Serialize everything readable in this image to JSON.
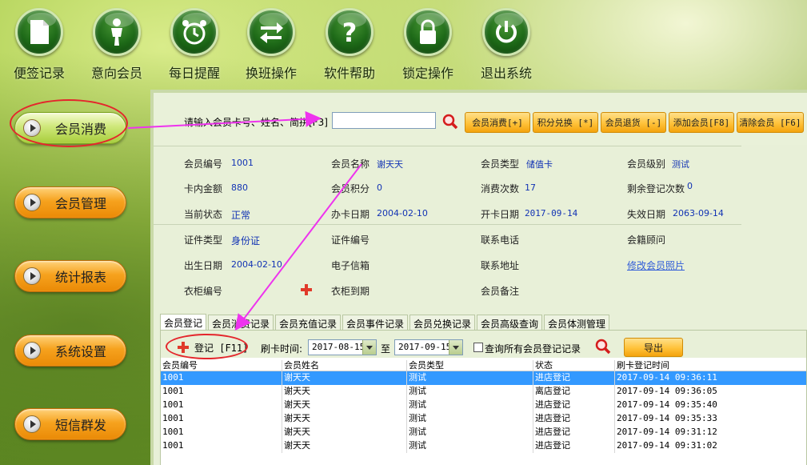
{
  "toolbar": {
    "items": [
      {
        "label": "便签记录",
        "icon": "document-icon"
      },
      {
        "label": "意向会员",
        "icon": "person-icon"
      },
      {
        "label": "每日提醒",
        "icon": "alarm-clock-icon"
      },
      {
        "label": "换班操作",
        "icon": "swap-arrows-icon"
      },
      {
        "label": "软件帮助",
        "icon": "question-icon"
      },
      {
        "label": "锁定操作",
        "icon": "lock-icon"
      },
      {
        "label": "退出系统",
        "icon": "power-icon"
      }
    ]
  },
  "sidebar": {
    "items": [
      {
        "label": "会员消费",
        "active": true
      },
      {
        "label": "会员管理",
        "active": false
      },
      {
        "label": "统计报表",
        "active": false
      },
      {
        "label": "系统设置",
        "active": false
      },
      {
        "label": "短信群发",
        "active": false
      }
    ]
  },
  "search": {
    "prompt": "请输入会员卡号、姓名、简拼[F3]",
    "value": "",
    "buttons": [
      "会员消费[+]",
      "积分兑换 [*]",
      "会员退货 [-]",
      "添加会员[F8]",
      "清除会员 [F6]"
    ]
  },
  "member": {
    "row1": {
      "no_label": "会员编号",
      "no": "1001",
      "name_label": "会员名称",
      "name": "谢天天",
      "type_label": "会员类型",
      "type": "储值卡",
      "level_label": "会员级别",
      "level": "测试"
    },
    "row2": {
      "balance_label": "卡内金额",
      "balance": "880",
      "points_label": "会员积分",
      "points": "0",
      "visits_label": "消费次数",
      "visits": "17",
      "remaining_label": "剩余登记次数",
      "remaining": "0"
    },
    "row3": {
      "status_label": "当前状态",
      "status": "正常",
      "issue_label": "办卡日期",
      "issue": "2004-02-10",
      "open_label": "开卡日期",
      "open": "2017-09-14",
      "expire_label": "失效日期",
      "expire": "2063-09-14"
    },
    "row4": {
      "idtype_label": "证件类型",
      "idtype": "身份证",
      "idno_label": "证件编号",
      "phone_label": "联系电话",
      "advisor_label": "会籍顾问"
    },
    "row5": {
      "birth_label": "出生日期",
      "birth": "2004-02-10",
      "email_label": "电子信箱",
      "address_label": "联系地址",
      "photo_link": "修改会员照片"
    },
    "row6": {
      "locker_label": "衣柜编号",
      "locker_expire_label": "衣柜到期",
      "remark_label": "会员备注"
    }
  },
  "tabs": [
    "会员登记",
    "会员消费记录",
    "会员充值记录",
    "会员事件记录",
    "会员兑换记录",
    "会员高级查询",
    "会员体测管理"
  ],
  "register": {
    "button": "登记 [F11]",
    "time_label": "刷卡时间:",
    "from": "2017-08-15",
    "to_label": "至",
    "to": "2017-09-15",
    "all_label": "查询所有会员登记记录",
    "export": "导出"
  },
  "grid": {
    "columns": [
      "会员编号",
      "会员姓名",
      "会员类型",
      "状态",
      "刷卡登记时间"
    ],
    "rows": [
      [
        "1001",
        "谢天天",
        "测试",
        "进店登记",
        "2017-09-14 09:36:11"
      ],
      [
        "1001",
        "谢天天",
        "测试",
        "离店登记",
        "2017-09-14 09:36:05"
      ],
      [
        "1001",
        "谢天天",
        "测试",
        "进店登记",
        "2017-09-14 09:35:40"
      ],
      [
        "1001",
        "谢天天",
        "测试",
        "进店登记",
        "2017-09-14 09:35:33"
      ],
      [
        "1001",
        "谢天天",
        "测试",
        "进店登记",
        "2017-09-14 09:31:12"
      ],
      [
        "1001",
        "谢天天",
        "测试",
        "进店登记",
        "2017-09-14 09:31:02"
      ]
    ]
  },
  "colors": {
    "accent_orange": "#f6a21e",
    "value_blue": "#1233b4",
    "selection": "#3399ff",
    "annotation_red": "#e4262c",
    "annotation_arrow": "#ee33ee"
  }
}
